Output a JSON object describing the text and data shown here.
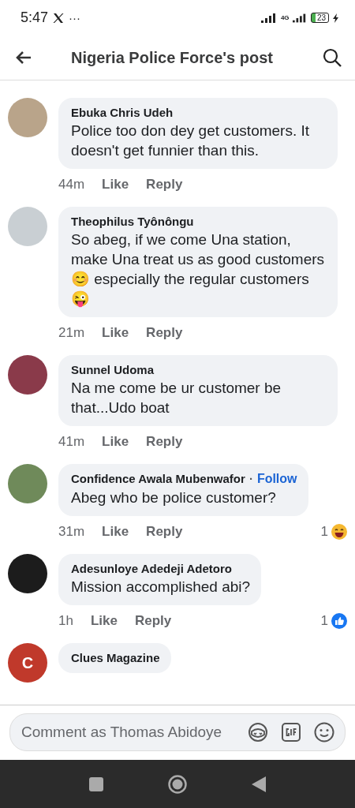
{
  "status_bar": {
    "time": "5:47",
    "more": "···",
    "network": "4G",
    "battery": "23"
  },
  "header": {
    "title": "Nigeria Police Force's post"
  },
  "comments": [
    {
      "author": "Ebuka Chris Udeh",
      "text": "Police too don dey get customers. It doesn't get funnier than this.",
      "time": "44m",
      "like": "Like",
      "reply": "Reply",
      "color": "#b9a48a"
    },
    {
      "author": "Theophilus Tyônôngu",
      "text": "So abeg, if we come Una station, make Una treat us as good customers 😊 especially the regular customers 😜",
      "time": "21m",
      "like": "Like",
      "reply": "Reply",
      "color": "#c9cfd3"
    },
    {
      "author": "Sunnel Udoma",
      "text": "Na me come be ur customer be that...Udo boat",
      "time": "41m",
      "like": "Like",
      "reply": "Reply",
      "color": "#8a3a4a"
    },
    {
      "author": "Confidence Awala Mubenwafor",
      "separator": "·",
      "follow": "Follow",
      "text": "Abeg who be police customer?",
      "time": "31m",
      "like": "Like",
      "reply": "Reply",
      "color": "#6f8a5a",
      "reaction": {
        "count": "1",
        "kind": "haha"
      }
    },
    {
      "author": "Adesunloye Adedeji Adetoro",
      "text": "Mission accomplished abi?",
      "time": "1h",
      "like": "Like",
      "reply": "Reply",
      "color": "#1c1c1c",
      "reaction": {
        "count": "1",
        "kind": "like"
      }
    },
    {
      "author": "Clues Magazine",
      "avatar_initial": "C",
      "color": "#c0392b"
    }
  ],
  "composer": {
    "placeholder": "Comment as Thomas Abidoye"
  }
}
